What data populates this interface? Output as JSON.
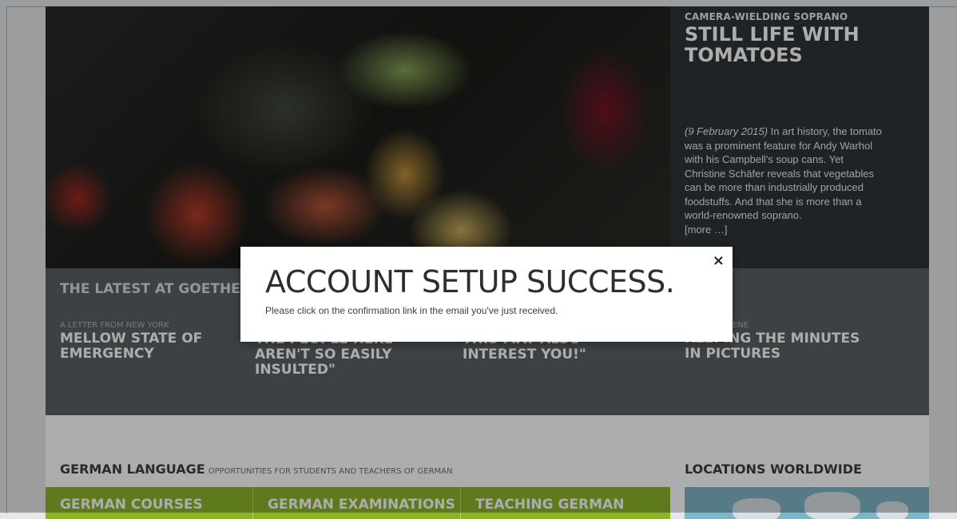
{
  "feature": {
    "kicker": "CAMERA-WIELDING SOPRANO",
    "title": "STILL LIFE WITH TOMATOES",
    "date": "(9 February 2015)",
    "text": " In art history, the tomato was a prominent feature for Andy Warhol with his Campbell's soup cans. Yet Christine Schäfer reveals that vegetables can be more than industrially produced foodstuffs. And that she is more than a world-renowned soprano.",
    "more": "[more …]"
  },
  "news": {
    "heading": "THE LATEST AT GOETHE",
    "items": [
      {
        "kicker": "A LETTER FROM NEW YORK",
        "title": "MELLOW STATE OF EMERGENCY"
      },
      {
        "kicker": "",
        "title": "THE PEOPLE HERE AREN'T SO EASILY INSULTED\""
      },
      {
        "kicker": "",
        "title": "THIS MAY ALSO INTEREST YOU!\""
      },
      {
        "kicker": "ENE",
        "title": "KEEPING THE MINUTES IN PICTURES"
      }
    ]
  },
  "language": {
    "heading": "GERMAN LANGUAGE",
    "subheading": "OPPORTUNITIES FOR STUDENTS AND TEACHERS OF GERMAN",
    "tabs": [
      "GERMAN COURSES",
      "GERMAN EXAMINATIONS",
      "TEACHING GERMAN"
    ]
  },
  "locations": {
    "heading": "LOCATIONS WORLDWIDE"
  },
  "modal": {
    "title": "ACCOUNT SETUP SUCCESS.",
    "text": "Please click on the confirmation link in the email you've just received.",
    "close": "×"
  }
}
